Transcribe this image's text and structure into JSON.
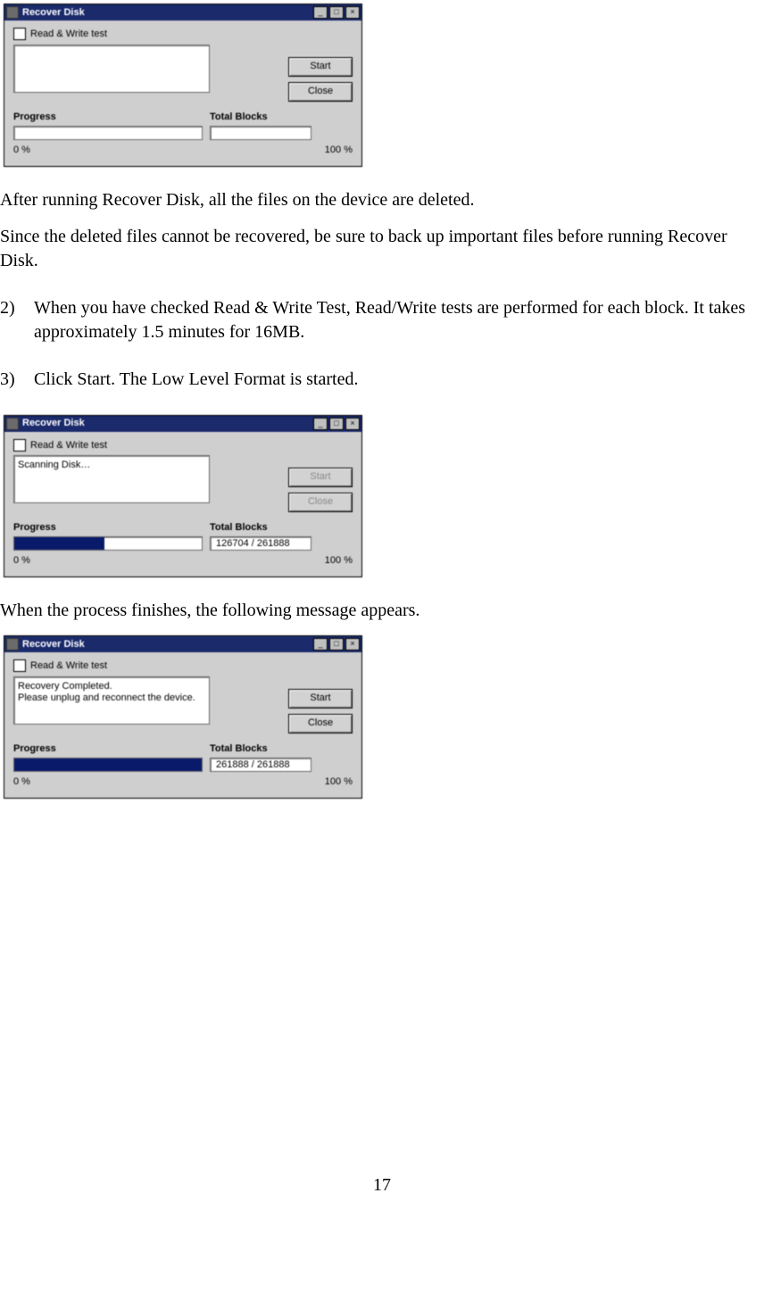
{
  "dialogs": {
    "d1": {
      "title": "Recover Disk",
      "checkbox": "Read & Write test",
      "status": "",
      "start": "Start",
      "close": "Close",
      "start_disabled": false,
      "close_disabled": false,
      "progress_label": "Progress",
      "totalblocks_label": "Total Blocks",
      "blocks": "",
      "progress_pct": 0,
      "scale_low": "0 %",
      "scale_high": "100 %"
    },
    "d2": {
      "title": "Recover Disk",
      "checkbox": "Read & Write test",
      "status": "Scanning Disk…",
      "start": "Start",
      "close": "Close",
      "start_disabled": true,
      "close_disabled": true,
      "progress_label": "Progress",
      "totalblocks_label": "Total Blocks",
      "blocks": "126704 / 261888",
      "progress_pct": 48,
      "scale_low": "0 %",
      "scale_high": "100 %"
    },
    "d3": {
      "title": "Recover Disk",
      "checkbox": "Read & Write test",
      "status_line1": "Recovery Completed.",
      "status_line2": "Please unplug and reconnect the device.",
      "start": "Start",
      "close": "Close",
      "start_disabled": false,
      "close_disabled": false,
      "progress_label": "Progress",
      "totalblocks_label": "Total Blocks",
      "blocks": "261888 / 261888",
      "progress_pct": 100,
      "scale_low": "0 %",
      "scale_high": "100 %"
    }
  },
  "text": {
    "p1": "After running Recover Disk, all the files on the device are deleted.",
    "p2": "Since the deleted files cannot be recovered, be sure to back up important files before running Recover Disk.",
    "n2_num": "2)",
    "n2_txt": "When you have checked Read & Write Test, Read/Write tests are performed for each block. It takes approximately 1.5 minutes for 16MB.",
    "n3_num": "3)",
    "n3_txt": "Click Start. The Low Level Format is started.",
    "p3": "When the process finishes, the following message appears.",
    "page": "17"
  }
}
